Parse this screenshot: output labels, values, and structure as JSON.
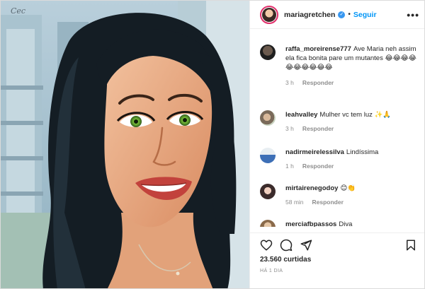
{
  "header": {
    "username": "mariagretchen",
    "separator": "•",
    "follow_label": "Seguir",
    "more_label": "•••",
    "verified_mark": "✓",
    "verified_color": "#3897f0",
    "follow_color": "#0095f6"
  },
  "photo": {
    "signature_text": "Cec"
  },
  "comments": [
    {
      "user": "raffa_moreirense777",
      "text": "Ave Maria neh assim ela fica bonita pare um mutantes 😂😂😂😂😂😂😂😂😂😂",
      "time": "3 h",
      "reply_label": "Responder"
    },
    {
      "user": "leahvalley",
      "text": "Mulher vc tem luz ✨🙏",
      "time": "3 h",
      "reply_label": "Responder"
    },
    {
      "user": "nadirmeirelessilva",
      "text": "Lindíssima",
      "time": "1 h",
      "reply_label": "Responder"
    },
    {
      "user": "mirtairenegodoy",
      "text": "😊👏",
      "time": "58 min",
      "reply_label": "Responder"
    },
    {
      "user": "merciafbpassos",
      "text": "Diva",
      "time": "",
      "reply_label": ""
    }
  ],
  "icons": [
    "heart-icon",
    "comment-icon",
    "share-icon",
    "bookmark-icon"
  ],
  "likes": "23.560 curtidas",
  "posted": "HÁ 1 DIA"
}
